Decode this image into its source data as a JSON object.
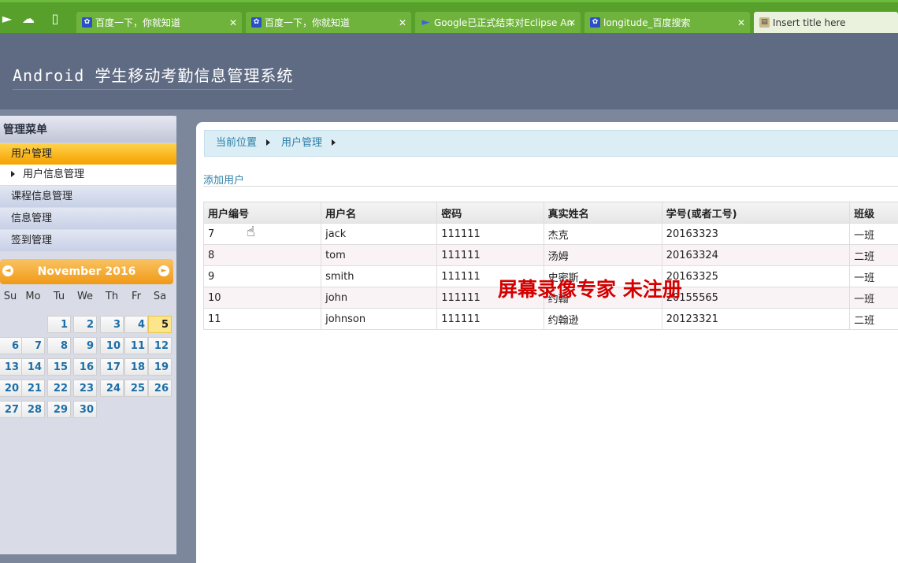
{
  "browser": {
    "tabs": [
      {
        "label": "百度一下，你就知道",
        "icon": "baidu-paw-icon"
      },
      {
        "label": "百度一下，你就知道",
        "icon": "baidu-paw-icon"
      },
      {
        "label": "Google已正式结束对Eclipse An",
        "icon": "play-arrow-icon"
      },
      {
        "label": "longitude_百度搜索",
        "icon": "baidu-paw-icon"
      },
      {
        "label": "Insert title here",
        "icon": "page-icon"
      }
    ],
    "close_glyph": "✕"
  },
  "header": {
    "title": "Android 学生移动考勤信息管理系统"
  },
  "sidebar": {
    "heading": "管理菜单",
    "items": [
      {
        "label": "用户管理"
      },
      {
        "label": "用户信息管理"
      },
      {
        "label": "课程信息管理"
      },
      {
        "label": "信息管理"
      },
      {
        "label": "签到管理"
      }
    ]
  },
  "calendar": {
    "month_label": "November 2016",
    "weekdays": [
      "Su",
      "Mo",
      "Tu",
      "We",
      "Th",
      "Fr",
      "Sa"
    ],
    "days": [
      "1",
      "2",
      "3",
      "4",
      "5",
      "6",
      "7",
      "8",
      "9",
      "10",
      "11",
      "12",
      "13",
      "14",
      "15",
      "16",
      "17",
      "18",
      "19",
      "20",
      "21",
      "22",
      "23",
      "24",
      "25",
      "26",
      "27",
      "28",
      "29",
      "30"
    ],
    "today": "5",
    "accent": "#f09a16"
  },
  "main": {
    "breadcrumb": [
      "当前位置",
      "用户管理"
    ],
    "add_user": "添加用户",
    "columns": [
      "用户编号",
      "用户名",
      "密码",
      "真实姓名",
      "学号(或者工号)",
      "班级"
    ],
    "rows": [
      [
        "7",
        "jack",
        "111111",
        "杰克",
        "20163323",
        "一班"
      ],
      [
        "8",
        "tom",
        "111111",
        "汤姆",
        "20163324",
        "二班"
      ],
      [
        "9",
        "smith",
        "111111",
        "史密斯",
        "20163325",
        "一班"
      ],
      [
        "10",
        "john",
        "111111",
        "约翰",
        "20155565",
        "一班"
      ],
      [
        "11",
        "johnson",
        "111111",
        "约翰逊",
        "20123321",
        "二班"
      ]
    ]
  },
  "watermark": "屏幕录像专家  未注册",
  "colors": {
    "tabbar": "#57a02c",
    "header": "#5f6b83",
    "menu_active": "#f5a200",
    "link": "#2c7fa6"
  }
}
